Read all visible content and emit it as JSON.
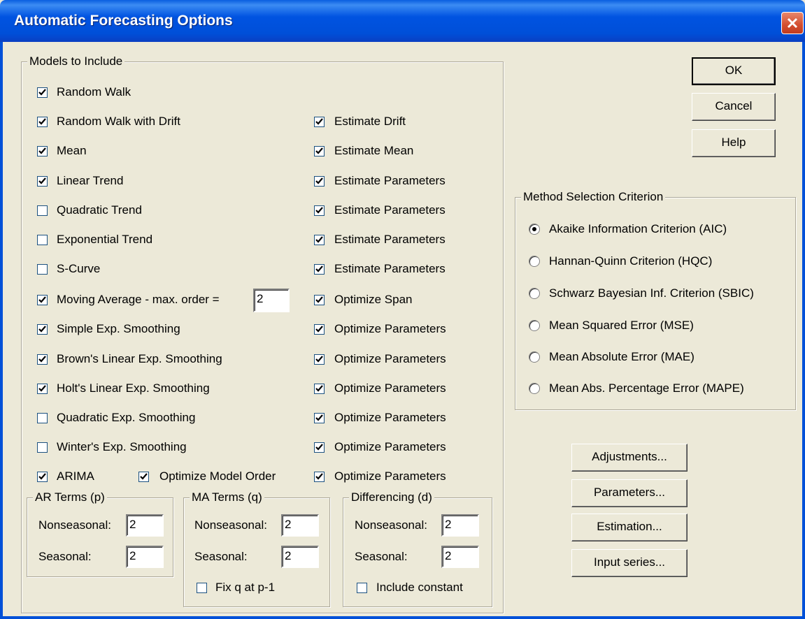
{
  "window": {
    "title": "Automatic Forecasting Options"
  },
  "models_group": {
    "legend": "Models to Include",
    "rows": [
      {
        "label": "Random Walk",
        "checked": true
      },
      {
        "label": "Random Walk with Drift",
        "checked": true,
        "option": "Estimate Drift",
        "option_checked": true
      },
      {
        "label": "Mean",
        "checked": true,
        "option": "Estimate Mean",
        "option_checked": true
      },
      {
        "label": "Linear Trend",
        "checked": true,
        "option": "Estimate Parameters",
        "option_checked": true
      },
      {
        "label": "Quadratic Trend",
        "checked": false,
        "option": "Estimate Parameters",
        "option_checked": true
      },
      {
        "label": "Exponential Trend",
        "checked": false,
        "option": "Estimate Parameters",
        "option_checked": true
      },
      {
        "label": "S-Curve",
        "checked": false,
        "option": "Estimate Parameters",
        "option_checked": true
      },
      {
        "label": "Moving Average - max. order =",
        "checked": true,
        "value": "2",
        "option": "Optimize Span",
        "option_checked": true
      },
      {
        "label": "Simple Exp. Smoothing",
        "checked": true,
        "option": "Optimize Parameters",
        "option_checked": true
      },
      {
        "label": "Brown's Linear Exp. Smoothing",
        "checked": true,
        "option": "Optimize Parameters",
        "option_checked": true
      },
      {
        "label": "Holt's Linear Exp. Smoothing",
        "checked": true,
        "option": "Optimize Parameters",
        "option_checked": true
      },
      {
        "label": "Quadratic Exp. Smoothing",
        "checked": false,
        "option": "Optimize Parameters",
        "option_checked": true
      },
      {
        "label": "Winter's Exp. Smoothing",
        "checked": false,
        "option": "Optimize Parameters",
        "option_checked": true
      },
      {
        "label": "ARIMA",
        "checked": true,
        "extra": "Optimize Model Order",
        "extra_checked": true,
        "option": "Optimize Parameters",
        "option_checked": true
      }
    ]
  },
  "ar_terms": {
    "legend": "AR Terms (p)",
    "nonseasonal_label": "Nonseasonal:",
    "nonseasonal_value": "2",
    "seasonal_label": "Seasonal:",
    "seasonal_value": "2"
  },
  "ma_terms": {
    "legend": "MA Terms (q)",
    "nonseasonal_label": "Nonseasonal:",
    "nonseasonal_value": "2",
    "seasonal_label": "Seasonal:",
    "seasonal_value": "2",
    "fix_label": "Fix q at p-1",
    "fix_checked": false
  },
  "differencing": {
    "legend": "Differencing (d)",
    "nonseasonal_label": "Nonseasonal:",
    "nonseasonal_value": "2",
    "seasonal_label": "Seasonal:",
    "seasonal_value": "2",
    "constant_label": "Include constant",
    "constant_checked": false
  },
  "buttons": {
    "ok": "OK",
    "cancel": "Cancel",
    "help": "Help",
    "adjustments": "Adjustments...",
    "parameters": "Parameters...",
    "estimation": "Estimation...",
    "input_series": "Input series..."
  },
  "criterion_group": {
    "legend": "Method Selection Criterion",
    "options": [
      {
        "label": "Akaike Information Criterion (AIC)",
        "selected": true
      },
      {
        "label": "Hannan-Quinn Criterion (HQC)",
        "selected": false
      },
      {
        "label": "Schwarz Bayesian Inf. Criterion (SBIC)",
        "selected": false
      },
      {
        "label": "Mean Squared Error (MSE)",
        "selected": false
      },
      {
        "label": "Mean Absolute Error (MAE)",
        "selected": false
      },
      {
        "label": "Mean Abs. Percentage Error (MAPE)",
        "selected": false
      }
    ]
  }
}
